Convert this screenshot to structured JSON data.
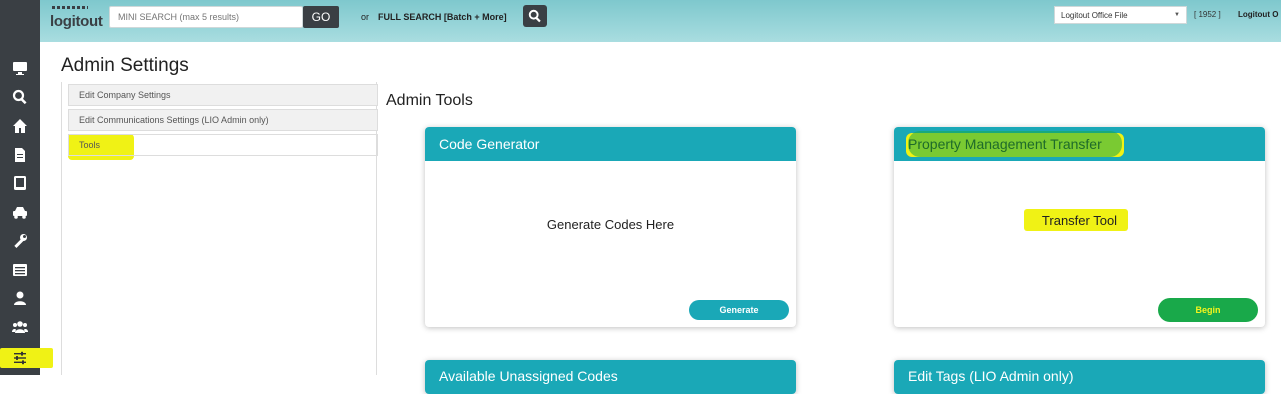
{
  "header": {
    "logo_text": "logitout",
    "mini_search_placeholder": "MINI SEARCH (max 5 results)",
    "go_label": "GO",
    "or_label": "or",
    "full_search_label": "FULL SEARCH [Batch + More]",
    "office_select_value": "Logitout Office File",
    "user_id": "[ 1952 ]",
    "user_name": "Logitout O"
  },
  "page": {
    "title": "Admin Settings"
  },
  "settings_menu": {
    "items": [
      {
        "label": "Edit Company Settings"
      },
      {
        "label": "Edit Communications Settings (LIO Admin only)"
      },
      {
        "label": "Tools"
      }
    ]
  },
  "tools": {
    "title": "Admin Tools",
    "cards": [
      {
        "title": "Code Generator",
        "text": "Generate Codes Here",
        "button": "Generate"
      },
      {
        "title": "Property Management Transfer",
        "text": "Transfer Tool",
        "button": "Begin"
      },
      {
        "title": "Available Unassigned Codes"
      },
      {
        "title": "Edit Tags (LIO Admin only)"
      }
    ]
  },
  "rail_icons": [
    "monitor-icon",
    "search-icon",
    "home-icon",
    "document-icon",
    "tablet-icon",
    "car-icon",
    "wrench-icon",
    "list-icon",
    "user-icon",
    "users-icon",
    "sliders-icon"
  ],
  "colors": {
    "accent": "#1aa8b7",
    "rail": "#3a3f44",
    "highlight_yellow": "#f0f215",
    "highlight_green": "#19a94a"
  }
}
